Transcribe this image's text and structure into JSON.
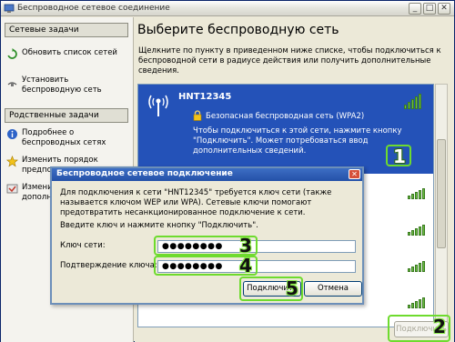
{
  "window": {
    "title": "Беспроводное сетевое соединение",
    "minimize": "_",
    "maximize": "□",
    "close": "✕"
  },
  "sidebar": {
    "network_tasks_header": "Сетевые задачи",
    "network_tasks": [
      {
        "label": "Обновить список сетей",
        "icon": "refresh-icon"
      },
      {
        "label": "Установить беспроводную сеть",
        "icon": "wireless-setup-icon"
      }
    ],
    "related_tasks_header": "Родственные задачи",
    "related_tasks": [
      {
        "label": "Подробнее о беспроводных сетях",
        "icon": "info-icon"
      },
      {
        "label": "Изменить порядок предпочтения",
        "icon": "star-icon"
      },
      {
        "label": "Изменить дополнительные параметры",
        "icon": "settings-icon"
      }
    ]
  },
  "main": {
    "heading": "Выберите беспроводную сеть",
    "description": "Щелкните по пункту в приведенном ниже списке, чтобы подключиться к беспроводной сети в радиусе действия или получить дополнительные сведения.",
    "selected_network": {
      "name": "HNT12345",
      "security": "Безопасная беспроводная сеть (WPA2)",
      "info": "Чтобы подключиться к этой сети, нажмите кнопку \"Подключить\". Может потребоваться ввод дополнительных сведений.",
      "signal_bars": 5
    },
    "connect_button": "Подключить"
  },
  "dialog": {
    "title": "Беспроводное сетевое подключение",
    "close": "✕",
    "text1": "Для подключения к сети \"HNT12345\" требуется ключ сети (также называется ключом WEP или WPA). Сетевые ключи помогают предотвратить несанкционированное подключение к сети.",
    "text2": "Введите ключ и нажмите кнопку \"Подключить\".",
    "key_label": "Ключ сети:",
    "key_value": "●●●●●●●●",
    "confirm_label": "Подтверждение ключа:",
    "confirm_value": "●●●●●●●●",
    "connect_button": "Подключить",
    "cancel_button": "Отмена"
  },
  "annotations": {
    "step1": "1",
    "step2": "2",
    "step3": "3",
    "step4": "4",
    "step5": "5",
    "highlight_color": "#6edb2e"
  },
  "colors": {
    "selection": "#2452b8",
    "signal": "#6abf3f",
    "dialog_title": "#2451a8"
  }
}
